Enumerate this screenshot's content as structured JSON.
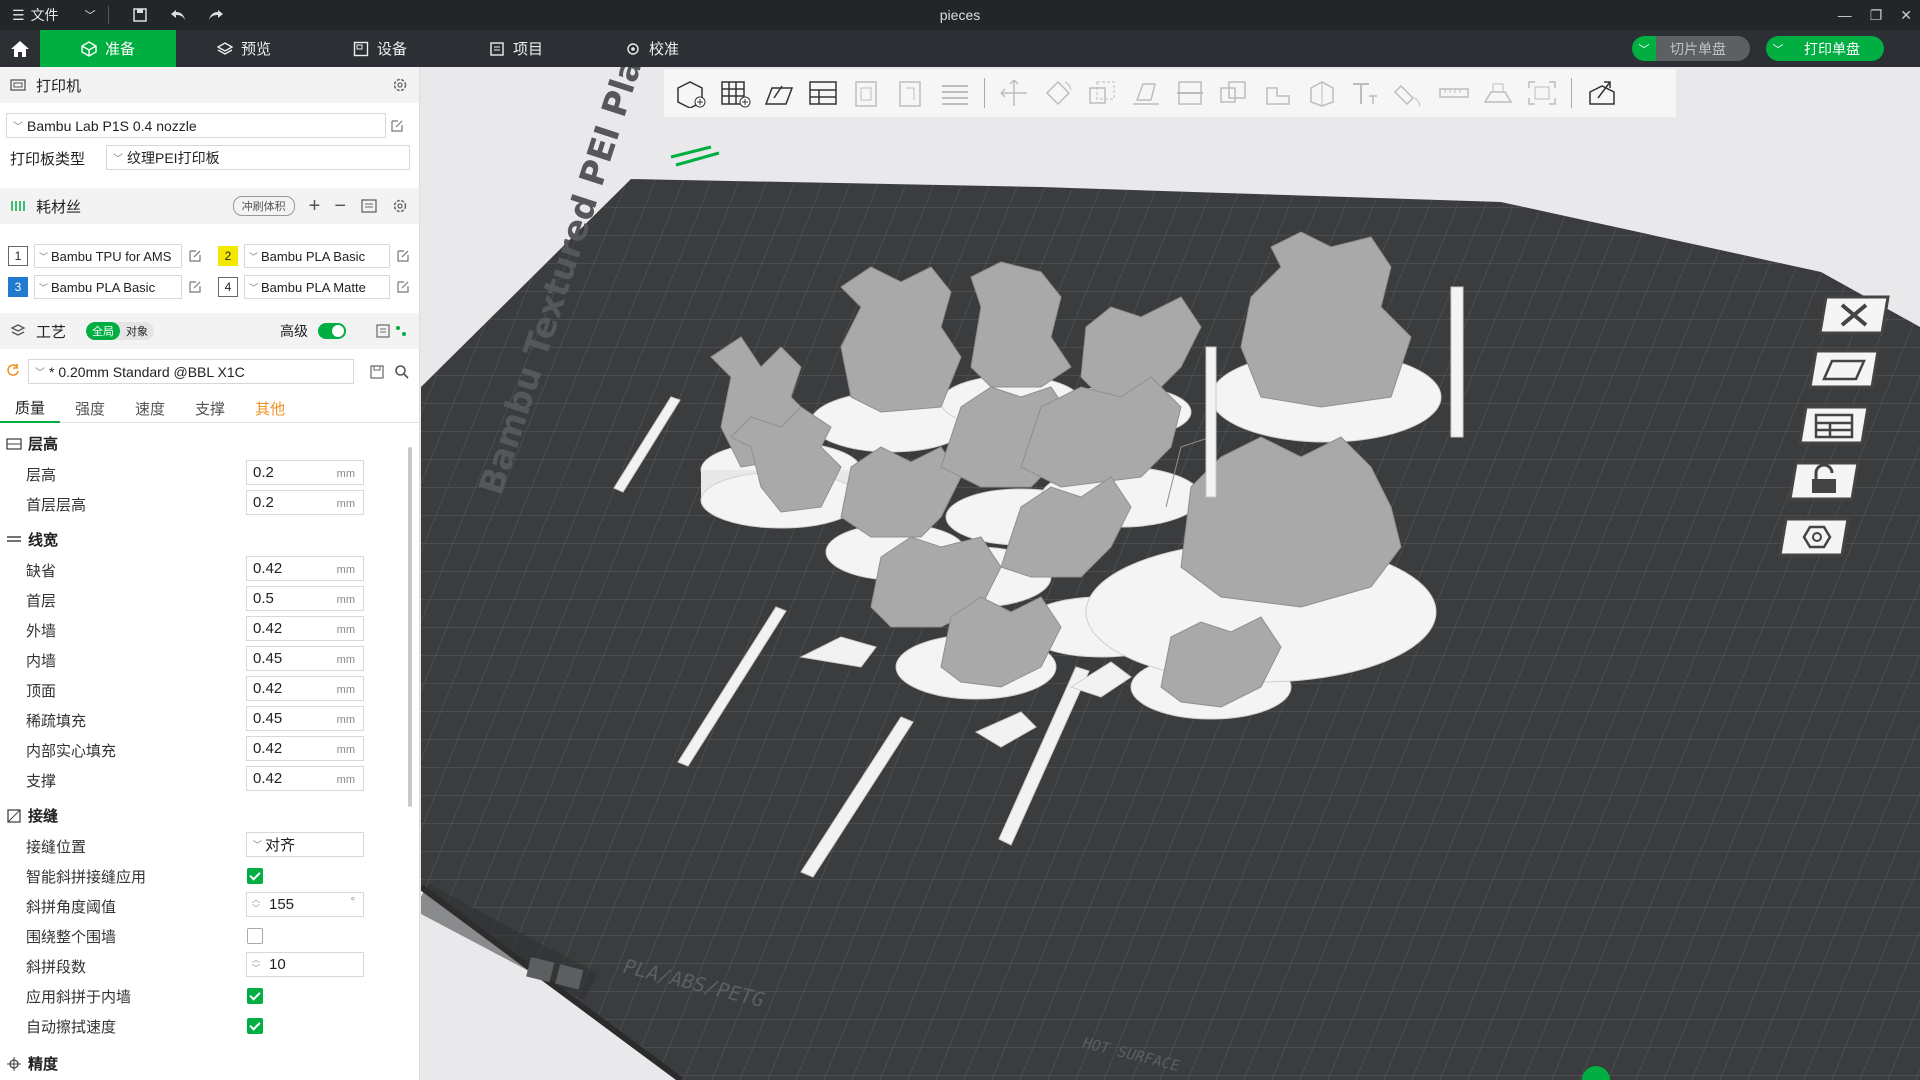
{
  "titlebar": {
    "menu_label": "文件",
    "title": "pieces"
  },
  "tabs": [
    {
      "label": "准备",
      "icon": "cube-icon"
    },
    {
      "label": "预览",
      "icon": "layers-icon"
    },
    {
      "label": "设备",
      "icon": "device-icon"
    },
    {
      "label": "项目",
      "icon": "project-icon"
    },
    {
      "label": "校准",
      "icon": "calibration-icon"
    }
  ],
  "actions": {
    "slice_label": "切片单盘",
    "print_label": "打印单盘"
  },
  "printer": {
    "section_title": "打印机",
    "printer_name": "Bambu Lab P1S 0.4 nozzle",
    "plate_type_label": "打印板类型",
    "plate_type_value": "纹理PEI打印板"
  },
  "filament": {
    "section_title": "耗材丝",
    "flush_label": "冲刷体积",
    "slots": [
      {
        "num": "1",
        "name": "Bambu TPU for AMS",
        "color": "#ffffff"
      },
      {
        "num": "2",
        "name": "Bambu PLA Basic",
        "color": "#f5e800"
      },
      {
        "num": "3",
        "name": "Bambu PLA Basic",
        "color": "#1f7ad0"
      },
      {
        "num": "4",
        "name": "Bambu PLA Matte",
        "color": "#ffffff"
      }
    ]
  },
  "process": {
    "section_title": "工艺",
    "global_label": "全局",
    "object_label": "对象",
    "advanced_label": "高级",
    "advanced_on": true,
    "preset": "* 0.20mm Standard @BBL X1C",
    "subtabs": [
      "质量",
      "强度",
      "速度",
      "支撑",
      "其他"
    ]
  },
  "quality": {
    "layer_height": {
      "title": "层高",
      "rows": [
        {
          "label": "层高",
          "value": "0.2",
          "unit": "mm"
        },
        {
          "label": "首层层高",
          "value": "0.2",
          "unit": "mm"
        }
      ]
    },
    "line_width": {
      "title": "线宽",
      "rows": [
        {
          "label": "缺省",
          "value": "0.42",
          "unit": "mm"
        },
        {
          "label": "首层",
          "value": "0.5",
          "unit": "mm"
        },
        {
          "label": "外墙",
          "value": "0.42",
          "unit": "mm"
        },
        {
          "label": "内墙",
          "value": "0.45",
          "unit": "mm"
        },
        {
          "label": "顶面",
          "value": "0.42",
          "unit": "mm"
        },
        {
          "label": "稀疏填充",
          "value": "0.45",
          "unit": "mm"
        },
        {
          "label": "内部实心填充",
          "value": "0.42",
          "unit": "mm"
        },
        {
          "label": "支撑",
          "value": "0.42",
          "unit": "mm"
        }
      ]
    },
    "seam": {
      "title": "接缝",
      "position_label": "接缝位置",
      "position_value": "对齐",
      "smart_scarf_label": "智能斜拼接缝应用",
      "smart_scarf_checked": true,
      "scarf_angle_label": "斜拼角度阈值",
      "scarf_angle_value": "155",
      "scarf_angle_unit": "°",
      "around_wall_label": "围绕整个围墙",
      "around_wall_checked": false,
      "scarf_steps_label": "斜拼段数",
      "scarf_steps_value": "10",
      "scarf_inner_label": "应用斜拼于内墙",
      "scarf_inner_checked": true,
      "auto_wipe_label": "自动擦拭速度",
      "auto_wipe_checked": true
    },
    "precision": {
      "title": "精度"
    }
  },
  "plate": {
    "brand_text": "Bambu Textured PEI Plate",
    "material_text": "PLA/ABS/PETG",
    "warning_text": "HOT SURFACE"
  }
}
